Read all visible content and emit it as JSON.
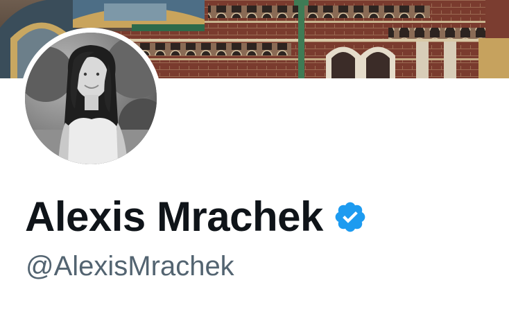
{
  "profile": {
    "display_name": "Alexis Mrachek",
    "handle": "@AlexisMrachek",
    "verified": true
  },
  "icons": {
    "verified": "verified-badge-icon"
  },
  "colors": {
    "name_text": "#0f1419",
    "handle_text": "#536471",
    "verified_badge": "#1d9bf0",
    "background": "#ffffff"
  }
}
